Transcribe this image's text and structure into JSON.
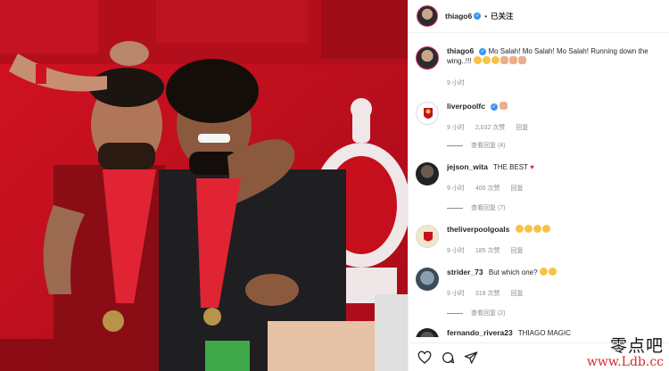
{
  "post": {
    "author": "thiago6",
    "follow_separator": "•",
    "follow_label": "已关注"
  },
  "caption": {
    "username": "thiago6",
    "text": "Mo Salah! Mo Salah! Mo Salah! Running down the wing..!!!",
    "time": "9 小时"
  },
  "comments": [
    {
      "username": "liverpoolfc",
      "text": "",
      "time": "9 小时",
      "likes": "2,032 次赞",
      "reply": "回复",
      "view_replies": "查看回复 (4)"
    },
    {
      "username": "jejson_wita",
      "text": "THE BEST",
      "time": "9 小时",
      "likes": "400 次赞",
      "reply": "回复",
      "view_replies": "查看回复 (7)"
    },
    {
      "username": "theliverpoolgoals",
      "text": "",
      "time": "9 小时",
      "likes": "185 次赞",
      "reply": "回复",
      "view_replies": ""
    },
    {
      "username": "strider_73",
      "text": "But which one?",
      "time": "9 小时",
      "likes": "318 次赞",
      "reply": "回复",
      "view_replies": "查看回复 (2)"
    },
    {
      "username": "fernando_rivera23",
      "text": "THIAGO MAGIC",
      "time": "",
      "likes": "",
      "reply": "",
      "view_replies": ""
    }
  ],
  "icons": [
    "heart-icon",
    "comment-icon",
    "share-icon"
  ],
  "watermark": {
    "top": "零点吧",
    "bottom": "www.Ldb.cc"
  },
  "colors": {
    "background_red": "#c8101d",
    "verified_blue": "#3897f0",
    "muted_text": "#8e8e8e",
    "watermark_red": "#d7282f"
  }
}
